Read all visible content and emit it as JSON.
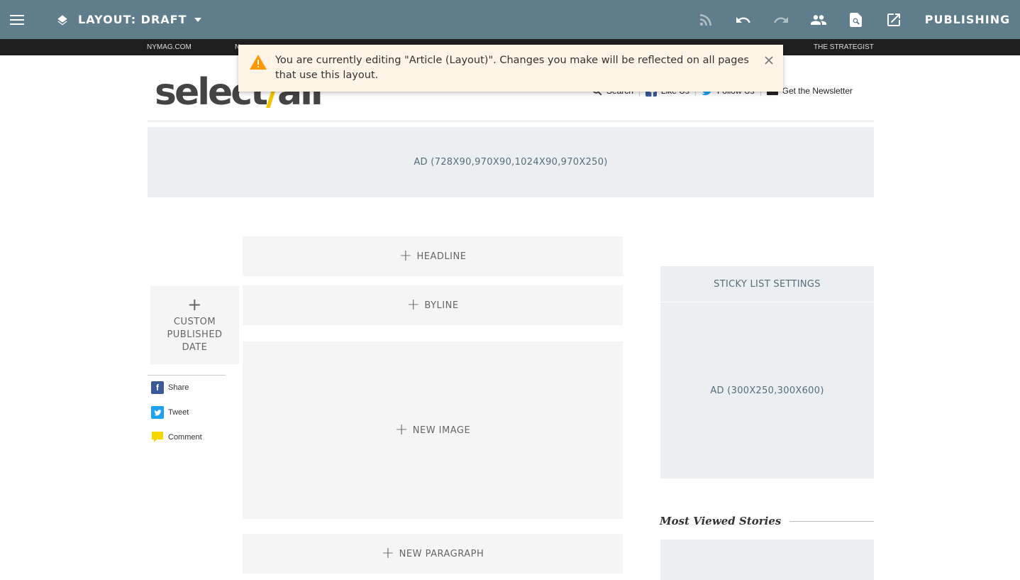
{
  "toolbar": {
    "layout_label": "LAYOUT: DRAFT",
    "publishing_label": "PUBLISHING"
  },
  "navbar": {
    "left": "NYMAG.COM",
    "left2": "N",
    "right": "THE STRATEGIST"
  },
  "alert": {
    "message": "You are currently editing \"Article (Layout)\". Changes you make will be reflected on all pages that use this layout."
  },
  "header": {
    "logo_part1": "select",
    "logo_y": "/",
    "logo_part2": "all",
    "links": {
      "search": "Search",
      "like": "Like Us",
      "follow": "Follow Us",
      "newsletter": "Get the Newsletter"
    }
  },
  "ads": {
    "top": "AD (728X90,970X90,1024X90,970X250)",
    "side": "AD (300X250,300X600)"
  },
  "placeholders": {
    "headline": "HEADLINE",
    "byline": "BYLINE",
    "image": "NEW IMAGE",
    "paragraph": "NEW PARAGRAPH",
    "date": "CUSTOM PUBLISHED DATE",
    "plus": "+"
  },
  "share": {
    "share": "Share",
    "tweet": "Tweet",
    "comment": "Comment"
  },
  "sidebar": {
    "sticky": "STICKY LIST SETTINGS",
    "most_viewed": "Most Viewed Stories"
  },
  "colors": {
    "toolbar": "#607d8b",
    "alert_bg": "#fff4e5",
    "warning": "#ff9800",
    "facebook": "#3b5998",
    "twitter": "#1da1f2",
    "comment": "#f5d800"
  }
}
